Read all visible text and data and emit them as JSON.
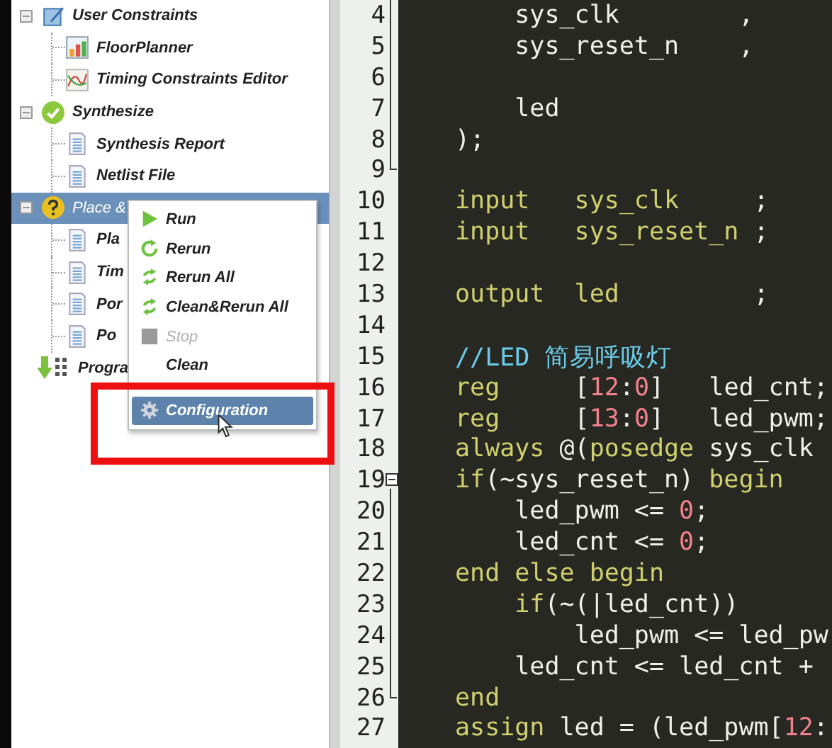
{
  "tree": [
    {
      "label": "User Constraints",
      "kind": "pencil",
      "expanded": true,
      "selected": false,
      "children": [
        {
          "label": "FloorPlanner",
          "kind": "bar-chart",
          "selected": false
        },
        {
          "label": "Timing Constraints Editor",
          "kind": "line-chart",
          "selected": false
        }
      ]
    },
    {
      "label": "Synthesize",
      "kind": "check",
      "expanded": true,
      "selected": false,
      "children": [
        {
          "label": "Synthesis Report",
          "kind": "document",
          "selected": false
        },
        {
          "label": "Netlist File",
          "kind": "document",
          "selected": false
        }
      ]
    },
    {
      "label": "Place &",
      "kind": "question",
      "expanded": true,
      "selected": true,
      "children": [
        {
          "label": "Pla",
          "kind": "document",
          "selected": false
        },
        {
          "label": "Tim",
          "kind": "document",
          "selected": false
        },
        {
          "label": "Por",
          "kind": "document",
          "selected": false
        },
        {
          "label": "Po",
          "kind": "document",
          "selected": false
        }
      ]
    },
    {
      "label": "Progra",
      "kind": "download",
      "selected": false
    }
  ],
  "context_menu": [
    {
      "kind": "play",
      "label": "Run",
      "disabled": false,
      "selected": false
    },
    {
      "kind": "rerun",
      "label": "Rerun",
      "disabled": false,
      "selected": false
    },
    {
      "kind": "rerun-all",
      "label": "Rerun All",
      "disabled": false,
      "selected": false
    },
    {
      "kind": "rerun-all",
      "label": "Clean&Rerun All",
      "disabled": false,
      "selected": false
    },
    {
      "kind": "stop",
      "label": "Stop",
      "disabled": true,
      "selected": false
    },
    {
      "kind": "plain",
      "label": "Clean",
      "disabled": false,
      "selected": false
    },
    {
      "kind": "separator"
    },
    {
      "kind": "gear",
      "label": "Configuration",
      "disabled": false,
      "selected": true
    }
  ],
  "editor": {
    "lines": [
      {
        "number": "4",
        "kind": "in-fold",
        "tokens": [
          {
            "kind": "identifier",
            "text": "    sys_clk        ,"
          }
        ]
      },
      {
        "number": "5",
        "kind": "in-fold",
        "tokens": [
          {
            "kind": "identifier",
            "text": "    sys_reset_n    ,"
          }
        ]
      },
      {
        "number": "6",
        "kind": "in-fold"
      },
      {
        "number": "7",
        "kind": "in-fold",
        "tokens": [
          {
            "kind": "identifier",
            "text": "    led"
          }
        ]
      },
      {
        "number": "8",
        "kind": "in-fold",
        "tokens": [
          {
            "kind": "identifier",
            "text": ");"
          }
        ]
      },
      {
        "number": "9",
        "kind": "fold-end"
      },
      {
        "number": "10",
        "kind": "plain",
        "tokens": [
          {
            "kind": "keyword",
            "text": "input   sys_clk     "
          },
          {
            "kind": "identifier",
            "text": ";"
          }
        ]
      },
      {
        "number": "11",
        "kind": "plain",
        "tokens": [
          {
            "kind": "keyword",
            "text": "input   sys_reset_n "
          },
          {
            "kind": "identifier",
            "text": ";"
          }
        ]
      },
      {
        "number": "12",
        "kind": "plain"
      },
      {
        "number": "13",
        "kind": "plain",
        "tokens": [
          {
            "kind": "keyword",
            "text": "output  led         "
          },
          {
            "kind": "identifier",
            "text": ";"
          }
        ]
      },
      {
        "number": "14",
        "kind": "plain"
      },
      {
        "number": "15",
        "kind": "plain",
        "tokens": [
          {
            "kind": "comment",
            "text": "//LED 简易呼吸灯"
          }
        ]
      },
      {
        "number": "16",
        "kind": "plain",
        "tokens": [
          {
            "kind": "keyword",
            "text": "reg     "
          },
          {
            "kind": "identifier",
            "text": "["
          },
          {
            "kind": "number",
            "text": "12"
          },
          {
            "kind": "identifier",
            "text": ":"
          },
          {
            "kind": "number",
            "text": "0"
          },
          {
            "kind": "identifier",
            "text": "]   led_cnt;"
          }
        ]
      },
      {
        "number": "17",
        "kind": "plain",
        "tokens": [
          {
            "kind": "keyword",
            "text": "reg     "
          },
          {
            "kind": "identifier",
            "text": "["
          },
          {
            "kind": "number",
            "text": "13"
          },
          {
            "kind": "identifier",
            "text": ":"
          },
          {
            "kind": "number",
            "text": "0"
          },
          {
            "kind": "identifier",
            "text": "]   led_pwm;"
          }
        ]
      },
      {
        "number": "18",
        "kind": "plain",
        "tokens": [
          {
            "kind": "keyword",
            "text": "always "
          },
          {
            "kind": "identifier",
            "text": "@("
          },
          {
            "kind": "keyword",
            "text": "posedge "
          },
          {
            "kind": "identifier",
            "text": "sys_clk"
          }
        ]
      },
      {
        "number": "19",
        "kind": "fold-start",
        "tokens": [
          {
            "kind": "keyword",
            "text": "if"
          },
          {
            "kind": "identifier",
            "text": "(~sys_reset_n) "
          },
          {
            "kind": "keyword",
            "text": "begin"
          }
        ]
      },
      {
        "number": "20",
        "kind": "in-fold",
        "tokens": [
          {
            "kind": "identifier",
            "text": "    led_pwm <= "
          },
          {
            "kind": "number",
            "text": "0"
          },
          {
            "kind": "identifier",
            "text": ";"
          }
        ]
      },
      {
        "number": "21",
        "kind": "in-fold",
        "tokens": [
          {
            "kind": "identifier",
            "text": "    led_cnt <= "
          },
          {
            "kind": "number",
            "text": "0"
          },
          {
            "kind": "identifier",
            "text": ";"
          }
        ]
      },
      {
        "number": "22",
        "kind": "in-fold",
        "tokens": [
          {
            "kind": "keyword",
            "text": "end else begin"
          }
        ]
      },
      {
        "number": "23",
        "kind": "in-fold",
        "tokens": [
          {
            "kind": "keyword",
            "text": "    if"
          },
          {
            "kind": "identifier",
            "text": "(~(|led_cnt))"
          }
        ]
      },
      {
        "number": "24",
        "kind": "in-fold",
        "tokens": [
          {
            "kind": "identifier",
            "text": "        led_pwm <= led_pw"
          }
        ]
      },
      {
        "number": "25",
        "kind": "in-fold",
        "tokens": [
          {
            "kind": "identifier",
            "text": "    led_cnt <= led_cnt +"
          }
        ]
      },
      {
        "number": "26",
        "kind": "fold-end",
        "tokens": [
          {
            "kind": "keyword",
            "text": "end"
          }
        ]
      },
      {
        "number": "27",
        "kind": "plain",
        "tokens": [
          {
            "kind": "keyword",
            "text": "assign "
          },
          {
            "kind": "identifier",
            "text": "led = (led_pwm["
          },
          {
            "kind": "number",
            "text": "12"
          },
          {
            "kind": "identifier",
            "text": ":"
          }
        ]
      }
    ]
  }
}
